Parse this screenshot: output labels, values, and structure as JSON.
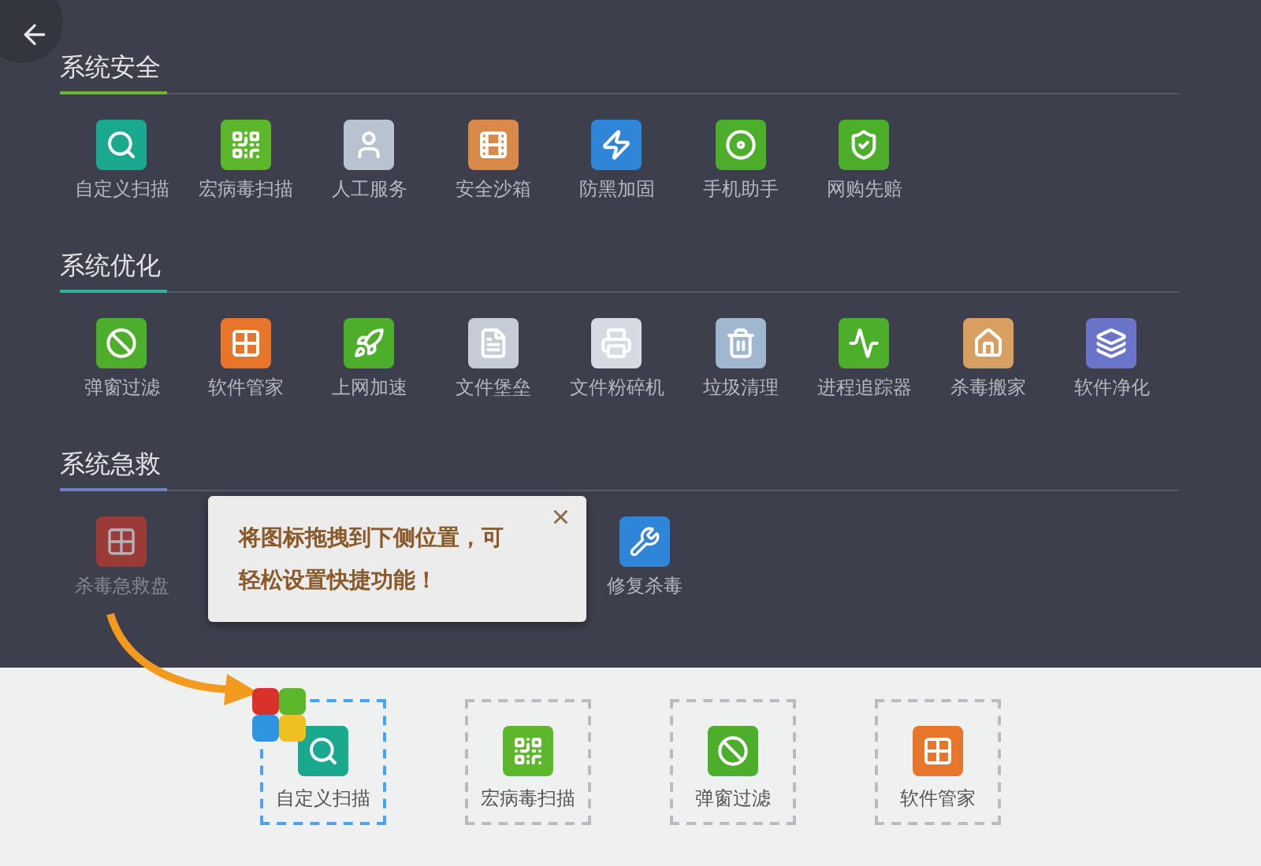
{
  "sections": [
    {
      "title": "系统安全",
      "color": "#6ab633",
      "items": [
        {
          "label": "自定义扫描"
        },
        {
          "label": "宏病毒扫描"
        },
        {
          "label": "人工服务"
        },
        {
          "label": "安全沙箱"
        },
        {
          "label": "防黑加固"
        },
        {
          "label": "手机助手"
        },
        {
          "label": "网购先赔"
        }
      ]
    },
    {
      "title": "系统优化",
      "color": "#2fb39a",
      "items": [
        {
          "label": "弹窗过滤"
        },
        {
          "label": "软件管家"
        },
        {
          "label": "上网加速"
        },
        {
          "label": "文件堡垒"
        },
        {
          "label": "文件粉碎机"
        },
        {
          "label": "垃圾清理"
        },
        {
          "label": "进程追踪器"
        },
        {
          "label": "杀毒搬家"
        },
        {
          "label": "软件净化"
        }
      ]
    },
    {
      "title": "系统急救",
      "color": "#6f7fc8",
      "items": [
        {
          "label": "杀毒急救盘",
          "dragging": true
        },
        {
          "label": "修复杀毒",
          "dragging": false
        }
      ]
    }
  ],
  "tip": {
    "text": "将图标拖拽到下侧位置，可轻松设置快捷功能！",
    "close": "×"
  },
  "dock": [
    {
      "label": "自定义扫描",
      "selected": true
    },
    {
      "label": "宏病毒扫描",
      "selected": false
    },
    {
      "label": "弹窗过滤",
      "selected": false
    },
    {
      "label": "软件管家",
      "selected": false
    }
  ]
}
